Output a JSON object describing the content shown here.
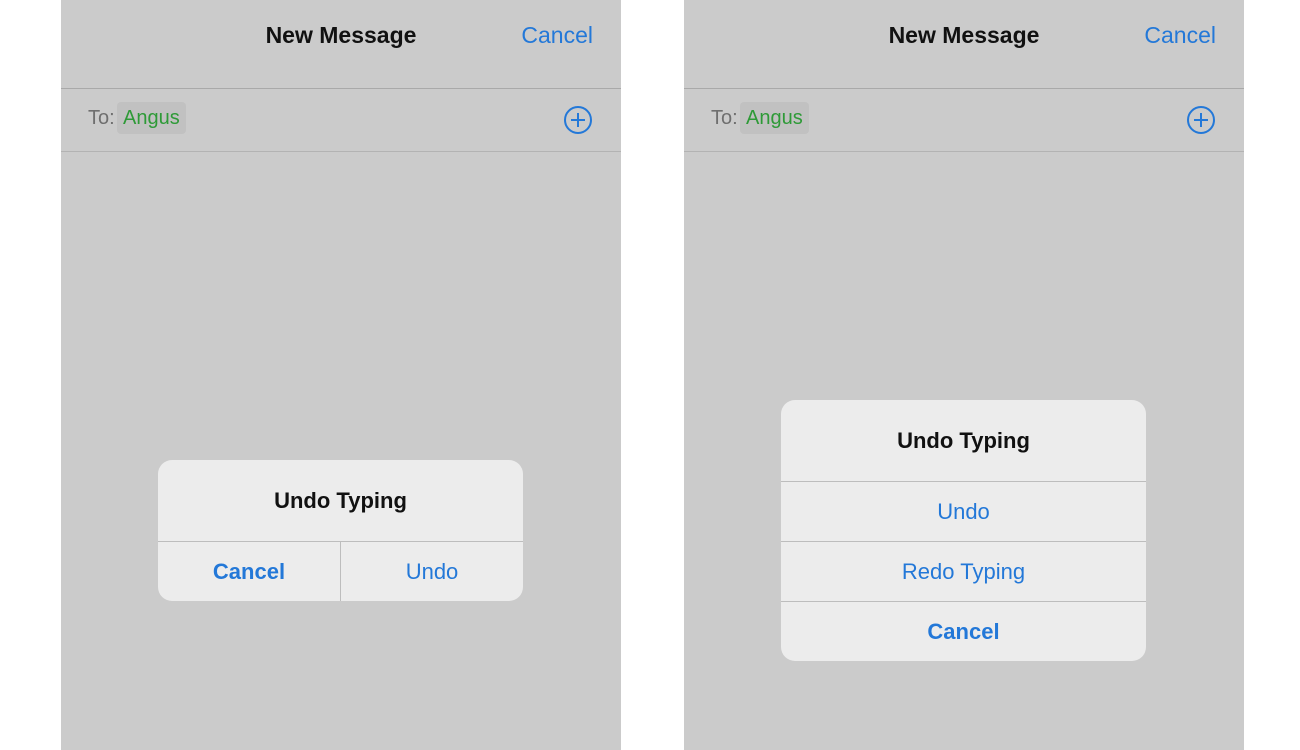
{
  "colors": {
    "accent": "#2378d8",
    "recipient": "#2e9a37",
    "background_dim": "#cbcbcb",
    "alert_background": "#ececec"
  },
  "left_screen": {
    "nav": {
      "title": "New Message",
      "cancel_label": "Cancel"
    },
    "to_field": {
      "label": "To:",
      "recipient": "Angus",
      "add_icon": "plus-circle-icon"
    },
    "alert": {
      "title": "Undo Typing",
      "buttons": [
        {
          "label": "Cancel",
          "style": "bold"
        },
        {
          "label": "Undo",
          "style": "regular"
        }
      ]
    }
  },
  "right_screen": {
    "nav": {
      "title": "New Message",
      "cancel_label": "Cancel"
    },
    "to_field": {
      "label": "To:",
      "recipient": "Angus",
      "add_icon": "plus-circle-icon"
    },
    "alert": {
      "title": "Undo Typing",
      "buttons": [
        {
          "label": "Undo",
          "style": "regular"
        },
        {
          "label": "Redo Typing",
          "style": "regular"
        },
        {
          "label": "Cancel",
          "style": "bold"
        }
      ]
    }
  }
}
